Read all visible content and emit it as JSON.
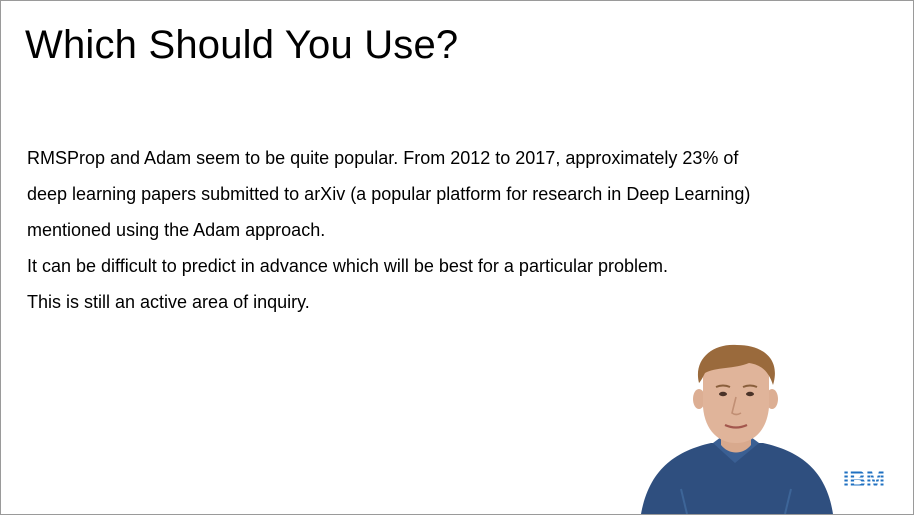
{
  "slide": {
    "title": "Which Should You Use?",
    "body_lines": [
      "RMSProp and Adam seem to be quite popular. From 2012 to 2017, approximately 23% of",
      "deep learning papers submitted to arXiv (a popular platform for research in Deep Learning)",
      "mentioned using the Adam approach.",
      "It can be difficult to predict in advance which will be best for a particular problem.",
      "This is still an active area of inquiry."
    ]
  },
  "logo": {
    "text": "IBM",
    "color": "#1f70c1"
  },
  "presenter": {
    "shirt_color": "#2f4f7f",
    "skin_color": "#e0b49a",
    "hair_color": "#9a6a3c"
  }
}
